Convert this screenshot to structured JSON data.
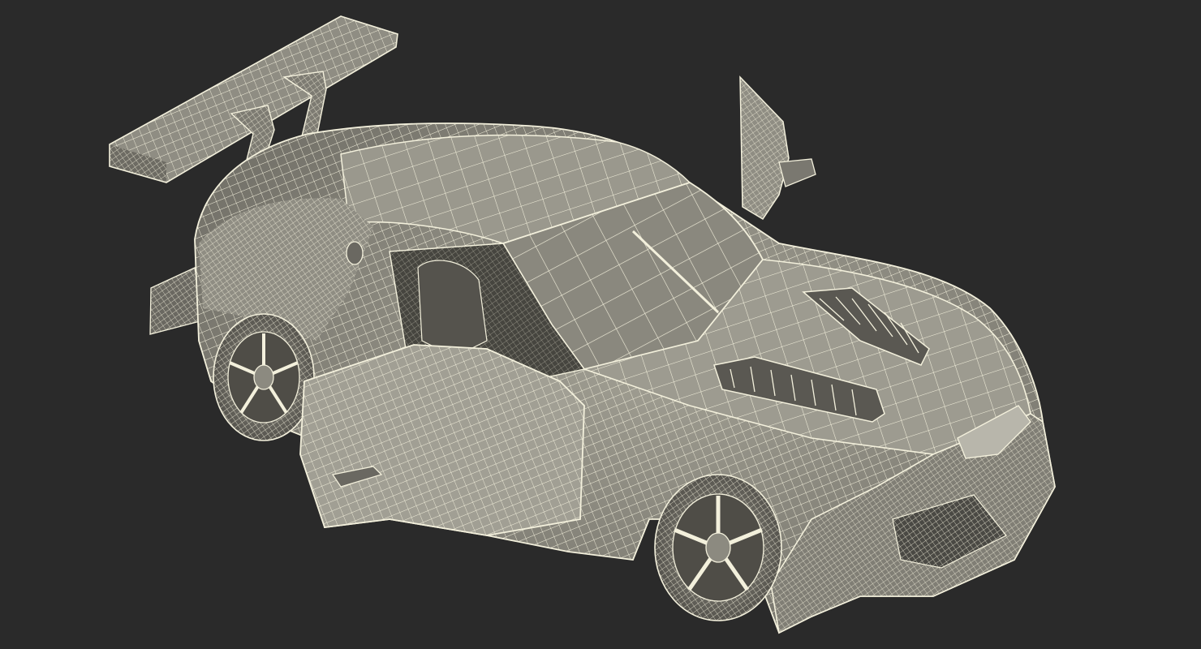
{
  "scene": {
    "subject": "wireframe-race-car-render",
    "colors": {
      "background": "#2a2a2a",
      "surface": "#8c8a80",
      "surface_light": "#a8a69b",
      "surface_dark": "#5f5d56",
      "wire": "#f3f0dc",
      "cockpit": "#45443f"
    },
    "doors": [
      "driver-door-open",
      "passenger-door-open"
    ],
    "wheels": [
      "rear-wheel",
      "front-wheel"
    ]
  }
}
